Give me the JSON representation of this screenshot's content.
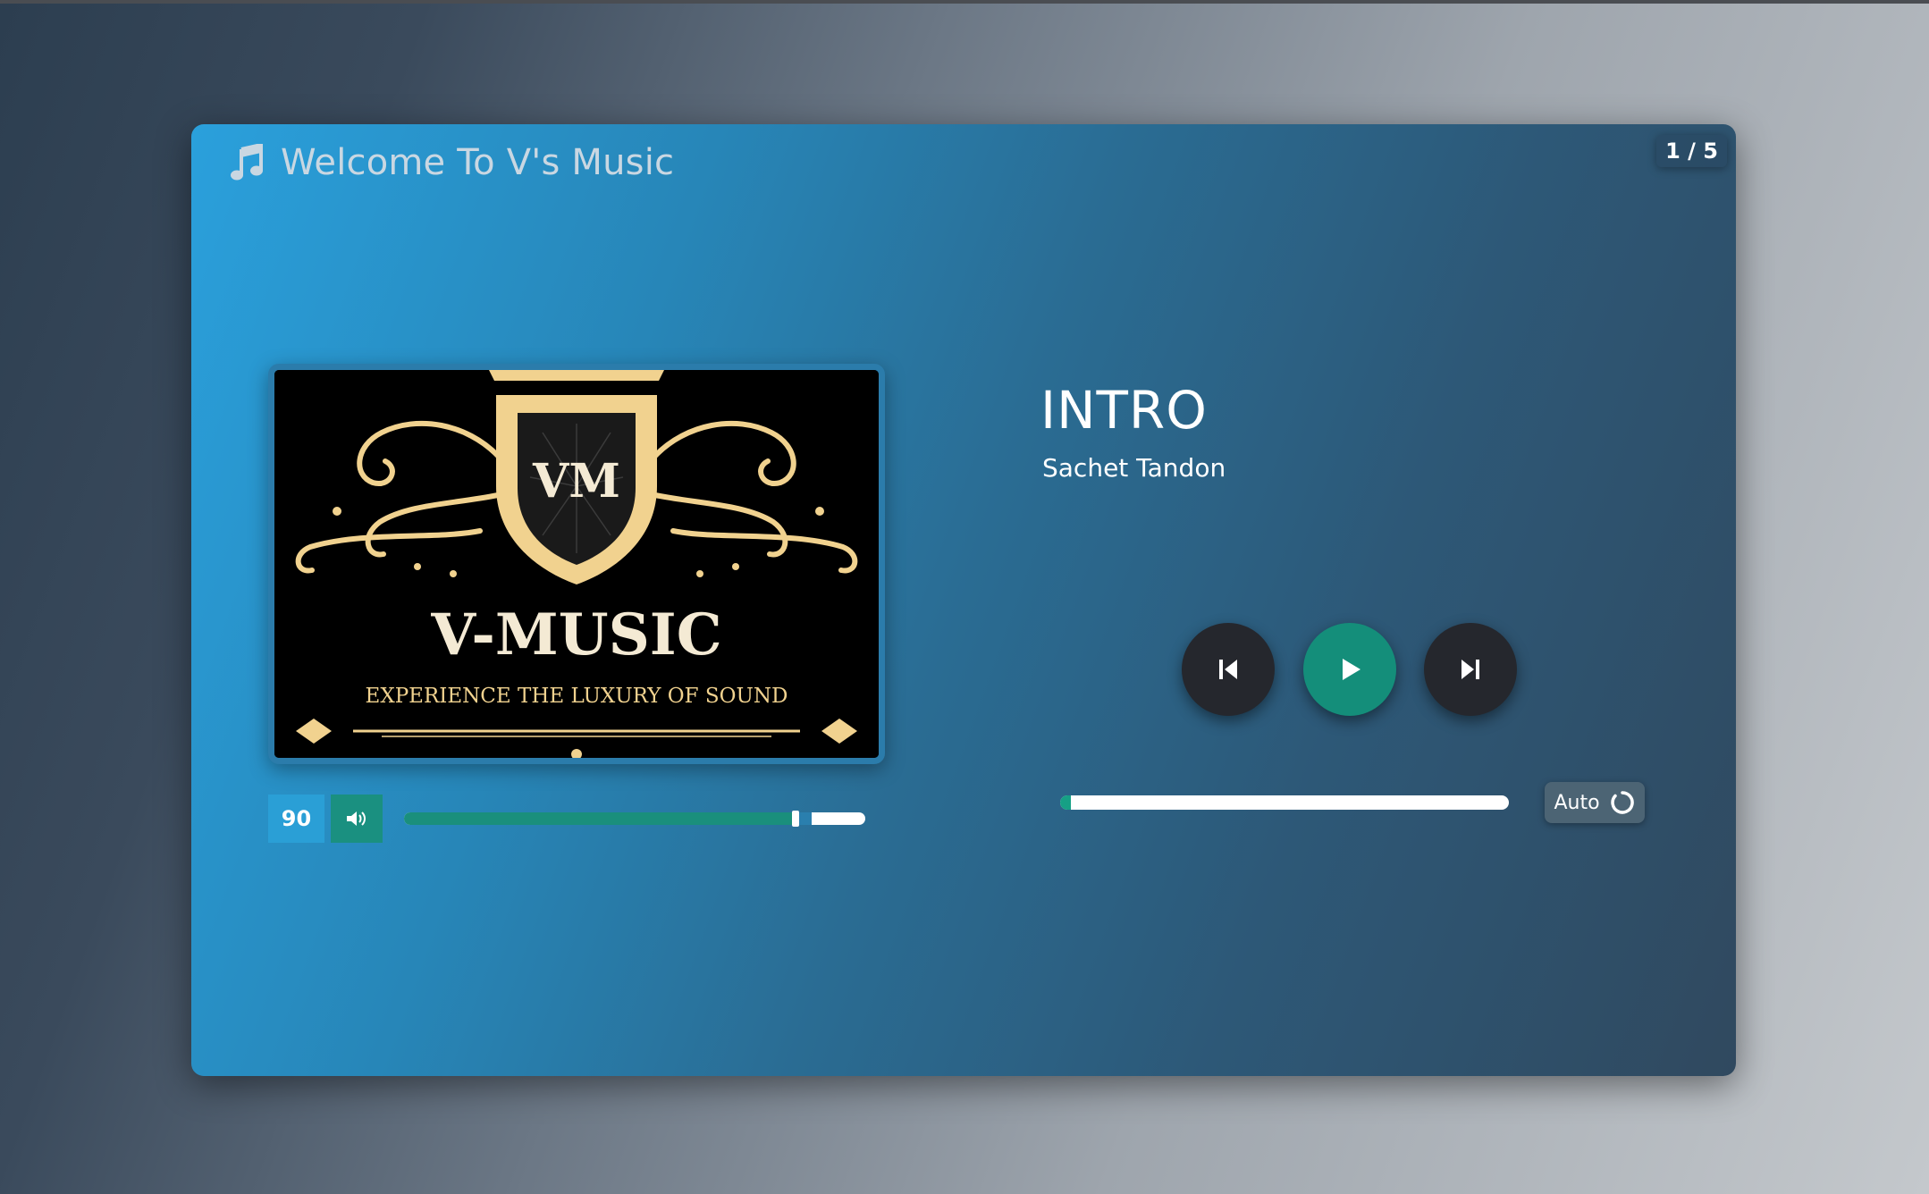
{
  "header": {
    "title": "Welcome To V's Music",
    "icon": "music-note-icon"
  },
  "counter": "1 / 5",
  "cover": {
    "monogram": "VM",
    "brand": "V-MUSIC",
    "tagline": "EXPERIENCE THE LUXURY OF SOUND"
  },
  "volume": {
    "value": "90",
    "level_fraction": 0.9,
    "icon": "speaker-icon"
  },
  "track": {
    "title": "INTRO",
    "artist": "Sachet Tandon",
    "progress_fraction": 0.02
  },
  "controls": {
    "prev_icon": "skip-previous-icon",
    "play_icon": "play-icon",
    "next_icon": "skip-next-icon",
    "auto_label": "Auto",
    "auto_icon": "loop-icon"
  },
  "colors": {
    "accent": "#148e7a",
    "control_dark": "#25272d",
    "gold": "#f1d28f"
  }
}
